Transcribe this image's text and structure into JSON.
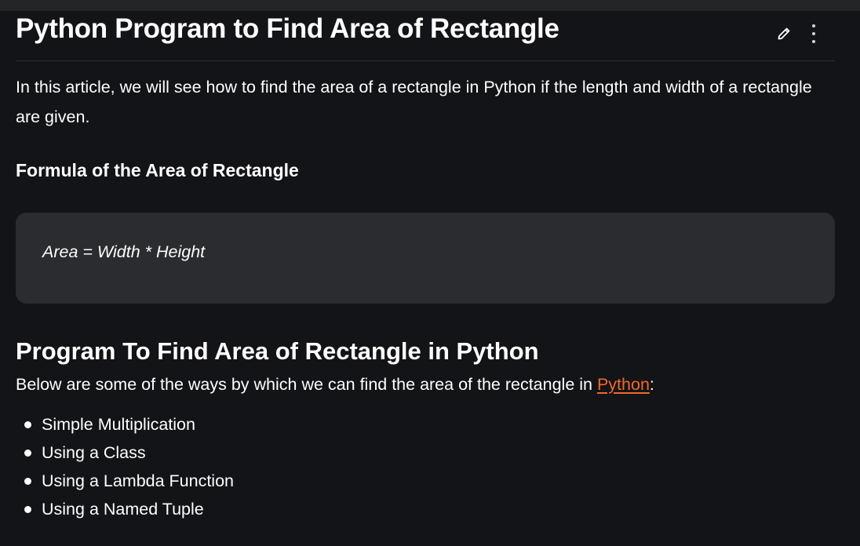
{
  "article": {
    "title": "Python Program to Find Area of Rectangle",
    "intro": "In this article, we will see how to find the area of a rectangle in Python if the length and width of a rectangle are given.",
    "formula_heading": "Formula of the Area of Rectangle",
    "formula": "Area = Width * Height",
    "program_heading": "Program To Find Area of Rectangle in Python",
    "program_desc_before": "Below are some of the ways by which we can find the area of the rectangle in ",
    "program_desc_link": "Python",
    "program_desc_after": ":",
    "methods": [
      "Simple Multiplication",
      "Using a Class",
      "Using a Lambda Function",
      "Using a Named Tuple"
    ]
  },
  "icons": {
    "edit": "pencil-icon",
    "more": "more-vertical-icon"
  },
  "colors": {
    "background": "#131417",
    "code_box": "#2b2c30",
    "link": "#f0682b",
    "text": "#ffffff"
  }
}
